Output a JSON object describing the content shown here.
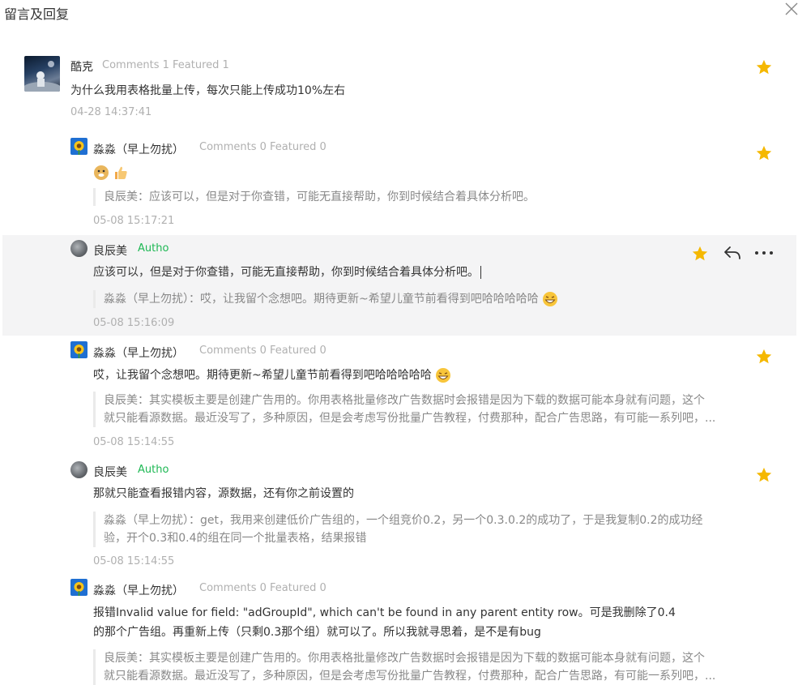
{
  "header": {
    "title": "留言及回复"
  },
  "icons": {
    "close": "close-icon",
    "star": "star-icon",
    "reply": "reply-icon",
    "more": "more-dots-icon"
  },
  "colors": {
    "star": "#f5b800",
    "author_tag": "#1eb854",
    "highlight_bg": "#f4f4f5"
  },
  "comments": [
    {
      "name": "酷克",
      "meta": "Comments 1 Featured 1",
      "content": "为什么我用表格批量上传，每次只能上传成功10%左右",
      "time": "04-28 14:37:41"
    },
    {
      "name": "淼淼（早上勿扰）",
      "meta": "Comments 0 Featured 0",
      "content": "",
      "quote": "良辰美：应该可以，但是对于你查错，可能无直接帮助，你到时候结合着具体分析吧。",
      "time": "05-08 15:17:21"
    },
    {
      "name": "良辰美",
      "tag": "Autho",
      "content": "应该可以，但是对于你查错，可能无直接帮助，你到时候结合着具体分析吧。",
      "quote": "淼淼（早上勿扰）：哎，让我留个念想吧。期待更新~希望儿童节前看得到吧哈哈哈哈哈",
      "time": "05-08 15:16:09"
    },
    {
      "name": "淼淼（早上勿扰）",
      "meta": "Comments 0 Featured 0",
      "content": "哎，让我留个念想吧。期待更新~希望儿童节前看得到吧哈哈哈哈哈",
      "quote_line1": "良辰美：其实模板主要是创建广告用的。你用表格批量修改广告数据时会报错是因为下载的数据可能本身就有问题，这个",
      "quote_line2": "就只能看源数据。最近没写了，多种原因，但是会考虑写份批量广告教程，付费那种，配合广告思路，有可能一系列吧，...",
      "time": "05-08 15:14:55"
    },
    {
      "name": "良辰美",
      "tag": "Autho",
      "content": "那就只能查看报错内容，源数据，还有你之前设置的",
      "quote_line1": "淼淼（早上勿扰）：get，我用来创建低价广告组的，一个组竞价0.2，另一个0.3.0.2的成功了，于是我复制0.2的成功经",
      "quote_line2": "验，开个0.3和0.4的组在同一个批量表格，结果报错",
      "time": "05-08 15:14:55"
    },
    {
      "name": "淼淼（早上勿扰）",
      "meta": "Comments 0 Featured 0",
      "content_line1": "报错Invalid value for field: \"adGroupId\", which can't be found in any parent entity row。可是我删除了0.4",
      "content_line2": "的那个广告组。再重新上传（只剩0.3那个组）就可以了。所以我就寻思着，是不是有bug",
      "quote_line1": "良辰美：其实模板主要是创建广告用的。你用表格批量修改广告数据时会报错是因为下载的数据可能本身就有问题，这个",
      "quote_line2": "就只能看源数据。最近没写了，多种原因，但是会考虑写份批量广告教程，付费那种，配合广告思路，有可能一系列吧，..."
    }
  ]
}
